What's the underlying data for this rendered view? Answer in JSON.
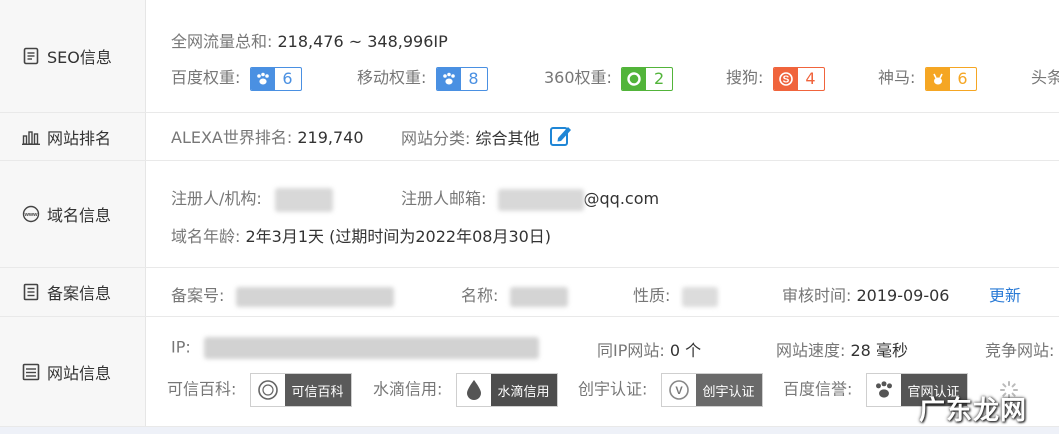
{
  "seo": {
    "label": "SEO信息",
    "traffic_label": "全网流量总和:",
    "traffic_value": "218,476 ~ 348,996IP",
    "weights": [
      {
        "label": "百度权重:",
        "value": "6",
        "icon": "paw-icon",
        "color": "#4a90e2"
      },
      {
        "label": "移动权重:",
        "value": "8",
        "icon": "paw-icon",
        "color": "#4a90e2"
      },
      {
        "label": "360权重:",
        "value": "2",
        "icon": "360-icon",
        "color": "#52b43a"
      },
      {
        "label": "搜狗:",
        "value": "4",
        "icon": "sogou-icon",
        "color": "#f0643c"
      },
      {
        "label": "神马:",
        "value": "6",
        "icon": "shenma-icon",
        "color": "#f5a623"
      }
    ],
    "trailing_label": "头条"
  },
  "rank": {
    "label": "网站排名",
    "alexa_label": "ALEXA世界排名:",
    "alexa_value": "219,740",
    "category_label": "网站分类:",
    "category_value": "综合其他"
  },
  "domain": {
    "label": "域名信息",
    "registrant_label": "注册人/机构:",
    "email_label": "注册人邮箱:",
    "email_suffix": "@qq.com",
    "age_label": "域名年龄:",
    "age_value": "2年3月1天 (过期时间为2022年08月30日)"
  },
  "icp": {
    "label": "备案信息",
    "number_label": "备案号:",
    "name_label": "名称:",
    "nature_label": "性质:",
    "review_label": "审核时间:",
    "review_value": "2019-09-06",
    "update_link": "更新"
  },
  "site": {
    "label": "网站信息",
    "ip_label": "IP:",
    "same_ip_label": "同IP网站:",
    "same_ip_value": "0 个",
    "speed_label": "网站速度:",
    "speed_value": "28 毫秒",
    "competitor_label": "竞争网站:",
    "certs": [
      {
        "label": "可信百科:",
        "badge": "可信百科",
        "icon": "seal-icon"
      },
      {
        "label": "水滴信用:",
        "badge": "水滴信用",
        "icon": "drop-icon"
      },
      {
        "label": "创宇认证:",
        "badge": "创宇认证",
        "icon": "shield-v-icon"
      },
      {
        "label": "百度信誉:",
        "badge": "官网认证",
        "icon": "paw-icon"
      }
    ]
  },
  "watermark": "广东龙网"
}
